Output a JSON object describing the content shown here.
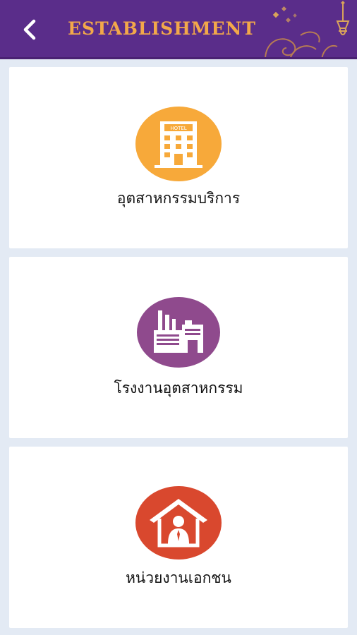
{
  "header": {
    "title": "ESTABLISHMENT",
    "back_icon": "chevron-left-icon",
    "background_color": "#5a2d8a",
    "title_color": "#f2a84a"
  },
  "cards": [
    {
      "label": "อุตสาหกรรมบริการ",
      "icon": "hotel-icon",
      "icon_text": "HOTEL",
      "color": "#f7a93a"
    },
    {
      "label": "โรงงานอุตสาหกรรม",
      "icon": "factory-icon",
      "color": "#8f4a8d"
    },
    {
      "label": "หน่วยงานเอกชน",
      "icon": "office-worker-icon",
      "color": "#d9482e"
    }
  ]
}
